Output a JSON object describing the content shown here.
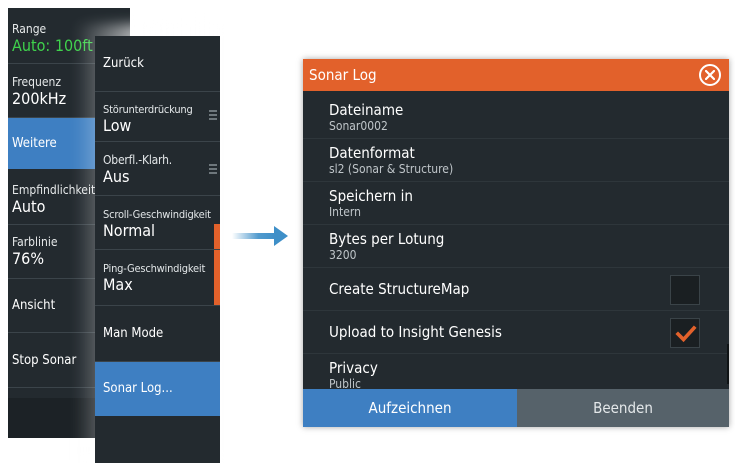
{
  "left_menu": {
    "range": {
      "label": "Range",
      "value": "Auto: 100ft"
    },
    "frequency": {
      "label": "Frequenz",
      "value": "200kHz"
    },
    "more": {
      "label": "Weitere"
    },
    "sensitivity": {
      "label": "Empfindlichkeit",
      "value": "Auto"
    },
    "colorline": {
      "label": "Farblinie",
      "value": "76%"
    },
    "view": {
      "label": "Ansicht"
    },
    "stop": {
      "label": "Stop Sonar"
    }
  },
  "sub_menu": {
    "back": {
      "label": "Zurück"
    },
    "noise": {
      "label": "Störunterdrückung",
      "value": "Low"
    },
    "surface": {
      "label": "Oberfl.-Klarh.",
      "value": "Aus"
    },
    "scroll_speed": {
      "label": "Scroll-Geschwindigkeit",
      "value": "Normal"
    },
    "ping_speed": {
      "label": "Ping-Geschwindigkeit",
      "value": "Max"
    },
    "man_mode": {
      "label": "Man Mode"
    },
    "sonar_log": {
      "label": "Sonar Log..."
    }
  },
  "dialog": {
    "title": "Sonar Log",
    "rows": [
      {
        "title": "Dateiname",
        "value": "Sonar0002"
      },
      {
        "title": "Datenformat",
        "value": "sl2 (Sonar & Structure)"
      },
      {
        "title": "Speichern in",
        "value": "Intern"
      },
      {
        "title": "Bytes per Lotung",
        "value": "3200"
      },
      {
        "title": "Create StructureMap",
        "checked": false
      },
      {
        "title": "Upload to Insight Genesis",
        "checked": true
      },
      {
        "title": "Privacy",
        "value": "Public"
      }
    ],
    "buttons": {
      "record": "Aufzeichnen",
      "exit": "Beenden"
    }
  },
  "colors": {
    "menu_bg": "#232a2f",
    "accent_blue": "#3e7fc2",
    "accent_orange": "#e2612b",
    "value_green": "#3fd24c"
  }
}
